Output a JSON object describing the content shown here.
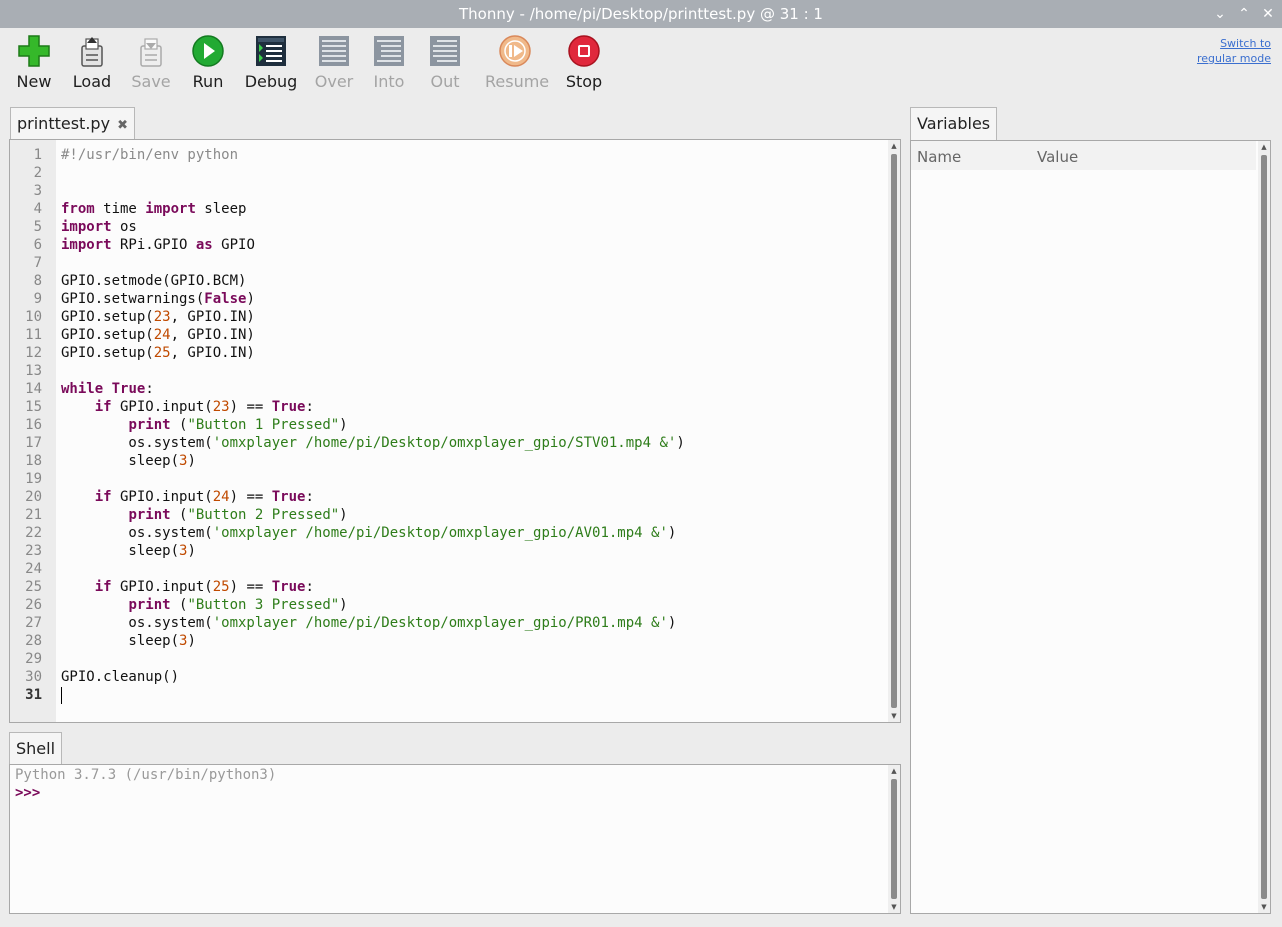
{
  "window": {
    "title": "Thonny  -  /home/pi/Desktop/printtest.py  @  31 : 1",
    "controls": {
      "minimize": "⌄",
      "maximize": "⌃",
      "close": "✕"
    }
  },
  "toolbar": {
    "buttons": [
      {
        "label": "New",
        "icon": "new-file-icon",
        "enabled": true
      },
      {
        "label": "Load",
        "icon": "load-file-icon",
        "enabled": true
      },
      {
        "label": "Save",
        "icon": "save-file-icon",
        "enabled": false
      },
      {
        "label": "Run",
        "icon": "run-icon",
        "enabled": true
      },
      {
        "label": "Debug",
        "icon": "debug-icon",
        "enabled": true
      },
      {
        "label": "Over",
        "icon": "step-over-icon",
        "enabled": false
      },
      {
        "label": "Into",
        "icon": "step-into-icon",
        "enabled": false
      },
      {
        "label": "Out",
        "icon": "step-out-icon",
        "enabled": false
      },
      {
        "label": "Resume",
        "icon": "resume-icon",
        "enabled": false
      },
      {
        "label": "Stop",
        "icon": "stop-icon",
        "enabled": true
      }
    ],
    "switch_mode": {
      "line1": "Switch to",
      "line2": "regular mode"
    }
  },
  "editor": {
    "tab_label": "printtest.py",
    "tab_close": "✖",
    "current_line": 31,
    "lines": [
      [
        [
          "cmt",
          "#!/usr/bin/env python"
        ]
      ],
      [],
      [],
      [
        [
          "kw",
          "from"
        ],
        [
          "t",
          " time "
        ],
        [
          "kw",
          "import"
        ],
        [
          "t",
          " sleep"
        ]
      ],
      [
        [
          "kw",
          "import"
        ],
        [
          "t",
          " os"
        ]
      ],
      [
        [
          "kw",
          "import"
        ],
        [
          "t",
          " RPi.GPIO "
        ],
        [
          "kw",
          "as"
        ],
        [
          "t",
          " GPIO"
        ]
      ],
      [],
      [
        [
          "t",
          "GPIO.setmode(GPIO.BCM)"
        ]
      ],
      [
        [
          "t",
          "GPIO.setwarnings("
        ],
        [
          "kw",
          "False"
        ],
        [
          "t",
          ")"
        ]
      ],
      [
        [
          "t",
          "GPIO.setup("
        ],
        [
          "num",
          "23"
        ],
        [
          "t",
          ", GPIO.IN)"
        ]
      ],
      [
        [
          "t",
          "GPIO.setup("
        ],
        [
          "num",
          "24"
        ],
        [
          "t",
          ", GPIO.IN)"
        ]
      ],
      [
        [
          "t",
          "GPIO.setup("
        ],
        [
          "num",
          "25"
        ],
        [
          "t",
          ", GPIO.IN)"
        ]
      ],
      [],
      [
        [
          "kw",
          "while"
        ],
        [
          "t",
          " "
        ],
        [
          "kw",
          "True"
        ],
        [
          "t",
          ":"
        ]
      ],
      [
        [
          "t",
          "    "
        ],
        [
          "kw",
          "if"
        ],
        [
          "t",
          " GPIO.input("
        ],
        [
          "num",
          "23"
        ],
        [
          "t",
          ") == "
        ],
        [
          "kw",
          "True"
        ],
        [
          "t",
          ":"
        ]
      ],
      [
        [
          "t",
          "        "
        ],
        [
          "kw",
          "print"
        ],
        [
          "t",
          " ("
        ],
        [
          "str",
          "\"Button 1 Pressed\""
        ],
        [
          "t",
          ")"
        ]
      ],
      [
        [
          "t",
          "        os.system("
        ],
        [
          "str",
          "'omxplayer /home/pi/Desktop/omxplayer_gpio/STV01.mp4 &'"
        ],
        [
          "t",
          ")"
        ]
      ],
      [
        [
          "t",
          "        sleep("
        ],
        [
          "num",
          "3"
        ],
        [
          "t",
          ")"
        ]
      ],
      [],
      [
        [
          "t",
          "    "
        ],
        [
          "kw",
          "if"
        ],
        [
          "t",
          " GPIO.input("
        ],
        [
          "num",
          "24"
        ],
        [
          "t",
          ") == "
        ],
        [
          "kw",
          "True"
        ],
        [
          "t",
          ":"
        ]
      ],
      [
        [
          "t",
          "        "
        ],
        [
          "kw",
          "print"
        ],
        [
          "t",
          " ("
        ],
        [
          "str",
          "\"Button 2 Pressed\""
        ],
        [
          "t",
          ")"
        ]
      ],
      [
        [
          "t",
          "        os.system("
        ],
        [
          "str",
          "'omxplayer /home/pi/Desktop/omxplayer_gpio/AV01.mp4 &'"
        ],
        [
          "t",
          ")"
        ]
      ],
      [
        [
          "t",
          "        sleep("
        ],
        [
          "num",
          "3"
        ],
        [
          "t",
          ")"
        ]
      ],
      [],
      [
        [
          "t",
          "    "
        ],
        [
          "kw",
          "if"
        ],
        [
          "t",
          " GPIO.input("
        ],
        [
          "num",
          "25"
        ],
        [
          "t",
          ") == "
        ],
        [
          "kw",
          "True"
        ],
        [
          "t",
          ":"
        ]
      ],
      [
        [
          "t",
          "        "
        ],
        [
          "kw",
          "print"
        ],
        [
          "t",
          " ("
        ],
        [
          "str",
          "\"Button 3 Pressed\""
        ],
        [
          "t",
          ")"
        ]
      ],
      [
        [
          "t",
          "        os.system("
        ],
        [
          "str",
          "'omxplayer /home/pi/Desktop/omxplayer_gpio/PR01.mp4 &'"
        ],
        [
          "t",
          ")"
        ]
      ],
      [
        [
          "t",
          "        sleep("
        ],
        [
          "num",
          "3"
        ],
        [
          "t",
          ")"
        ]
      ],
      [],
      [
        [
          "t",
          "GPIO.cleanup()"
        ]
      ],
      []
    ]
  },
  "shell": {
    "tab_label": "Shell",
    "banner": "Python 3.7.3 (/usr/bin/python3)",
    "prompt": ">>>"
  },
  "variables": {
    "tab_label": "Variables",
    "columns": [
      "Name",
      "Value"
    ]
  },
  "colors": {
    "keyword": "#7a0a5a",
    "number": "#c04a00",
    "string": "#2e7d1a",
    "comment": "#8a8a8a",
    "run": "#22aa33",
    "stop": "#e0283c",
    "link": "#3b6fcf"
  }
}
